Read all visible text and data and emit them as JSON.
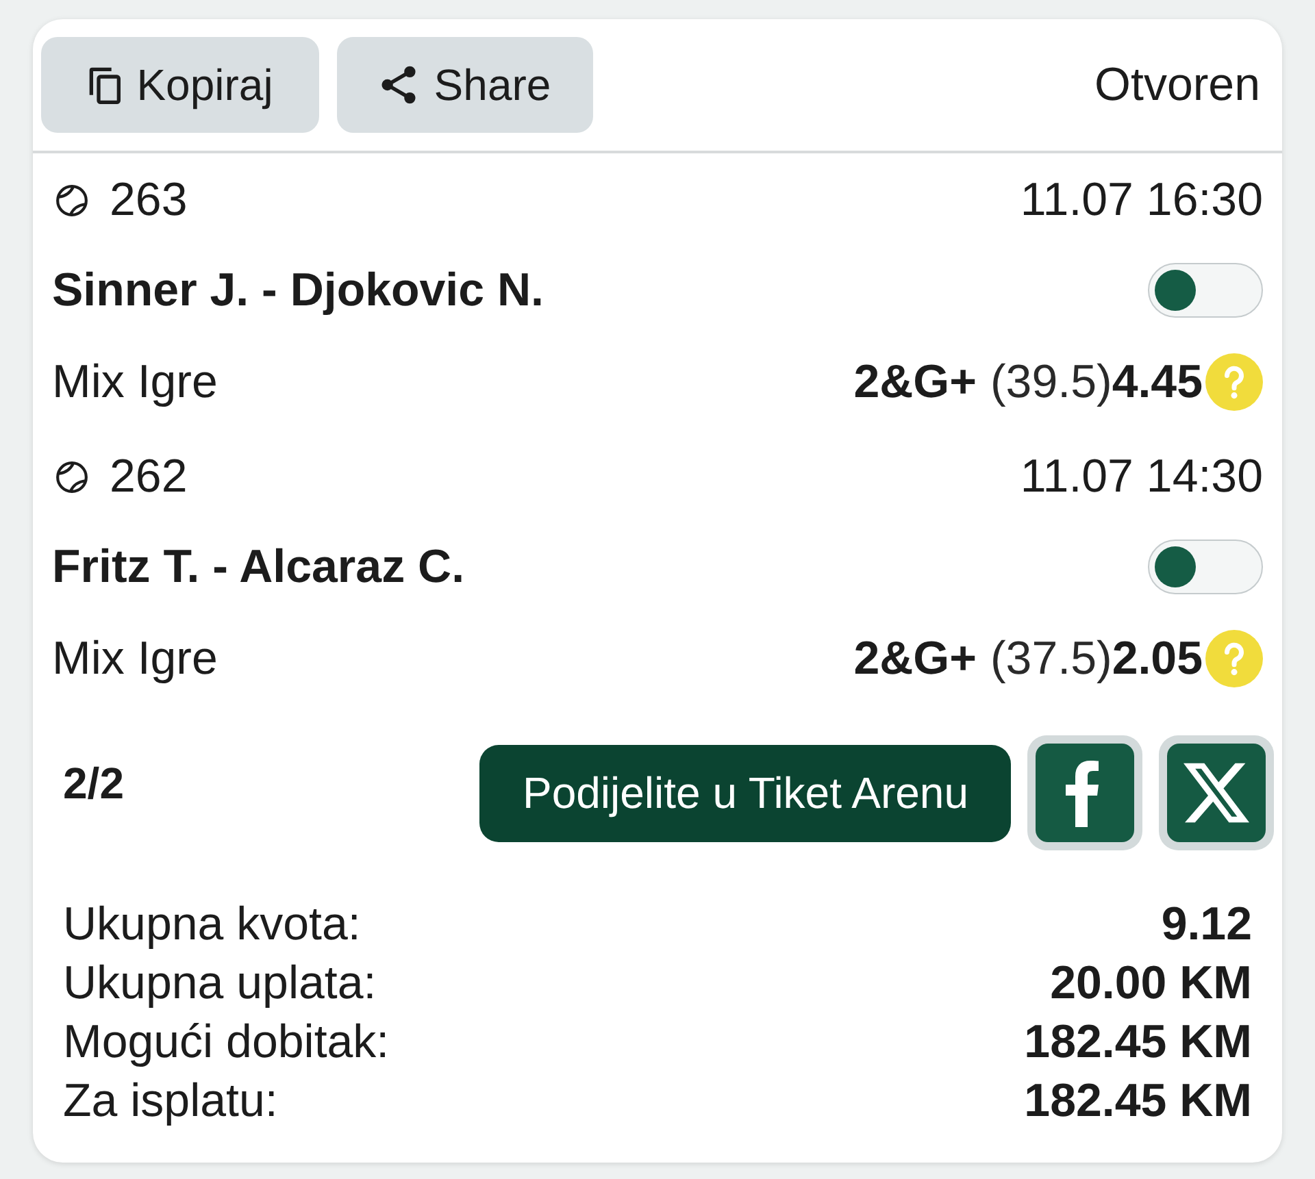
{
  "header": {
    "buttons": [
      {
        "kind": "copy",
        "label": "Kopiraj"
      },
      {
        "kind": "share",
        "label": "Share"
      }
    ],
    "status": "Otvoren"
  },
  "events": [
    {
      "number": "263",
      "datetime": "11.07 16:30",
      "match": "Sinner J. - Djokovic N.",
      "on": false,
      "market": "Mix Igre",
      "pick": "2&G+",
      "line": "(39.5)",
      "odds": "4.45"
    },
    {
      "number": "262",
      "datetime": "11.07 14:30",
      "match": "Fritz T. - Alcaraz C.",
      "on": false,
      "market": "Mix Igre",
      "pick": "2&G+",
      "line": "(37.5)",
      "odds": "2.05"
    }
  ],
  "footer": {
    "count": "2/2",
    "share_button": "Podijelite u Tiket Arenu",
    "social": [
      {
        "kind": "facebook"
      },
      {
        "kind": "x"
      }
    ]
  },
  "summary": [
    {
      "label": "Ukupna kvota:",
      "value": "9.12"
    },
    {
      "label": "Ukupna uplata:",
      "value": "20.00 KM"
    },
    {
      "label": "Mogući dobitak:",
      "value": "182.45 KM"
    },
    {
      "label": "Za isplatu:",
      "value": "182.45 KM"
    }
  ]
}
